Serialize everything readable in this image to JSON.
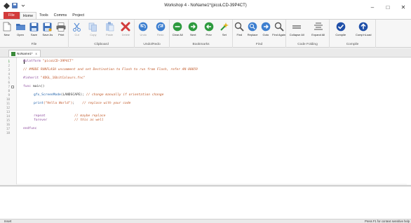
{
  "window": {
    "title": "Workshop 4 - NoName1*(picoLCD-39P4CT)",
    "controls": {
      "minimize": "–",
      "maximize": "□",
      "close": "✕"
    }
  },
  "menu": {
    "tabs": [
      "File",
      "Home",
      "Tools",
      "Comms",
      "Project"
    ],
    "active": "Home"
  },
  "ribbon": {
    "groups": [
      {
        "label": "File",
        "buttons": [
          "New",
          "Open",
          "Save",
          "Save As",
          "Print"
        ]
      },
      {
        "label": "Clipboard",
        "buttons": [
          "Cut",
          "Copy",
          "Paste",
          "Delete"
        ]
      },
      {
        "label": "Undo/Redo",
        "buttons": [
          "Undo",
          "Redo"
        ]
      },
      {
        "label": "Bookmarks",
        "buttons": [
          "Clear All",
          "Next",
          "Prev",
          "Set"
        ]
      },
      {
        "label": "Find",
        "buttons": [
          "Find",
          "Replace",
          "Goto",
          "Find Again"
        ]
      },
      {
        "label": "Code Folding",
        "buttons": [
          "Collapse All",
          "Expand All"
        ]
      },
      {
        "label": "Compile",
        "buttons": [
          "Compile",
          "Comp'nLoad"
        ]
      }
    ]
  },
  "doc_tab": {
    "label": "NoName1*",
    "close": "x"
  },
  "editor": {
    "line_numbers": [
      "1",
      "2",
      "3",
      "4",
      "5",
      "6",
      "7",
      "8",
      "9",
      "10",
      "11",
      "12",
      "13",
      "14",
      "15",
      "16",
      "17",
      "18"
    ],
    "lines": {
      "l1": {
        "kw": "#platform",
        "str": "\"picoLCD-39P4CT\""
      },
      "l3": "// #MODE RUNFLASH uncomment and set Destination to Flash to run from Flash, refer AN-00059",
      "l5": {
        "kw": "#inherit",
        "str": "\"4DGL_16bitColours.fnc\""
      },
      "l7": {
        "kw": "func",
        "rest": "main()"
      },
      "l9": {
        "fn": "gfx_ScreenMode",
        "arg": "(LANDSCAPE)",
        "sep": ";",
        "cm": "// change manually if orientation change"
      },
      "l11": {
        "fn": "print",
        "str": "(\"Hello World\")",
        "sep": ";",
        "cm": "// replace with your code"
      },
      "l14": {
        "kw": "repeat",
        "cm": "// maybe replace"
      },
      "l15": {
        "kw": "forever",
        "cm": "// this as well"
      },
      "l17": {
        "kw": "endfunc"
      }
    }
  },
  "status": {
    "left": "Insert",
    "right": "Press F1 for context sensitive help"
  },
  "colors": {
    "file_tab": "#d23b3b",
    "keyword": "#8b4a9c",
    "string": "#c0562a",
    "function": "#1c5fa8"
  }
}
